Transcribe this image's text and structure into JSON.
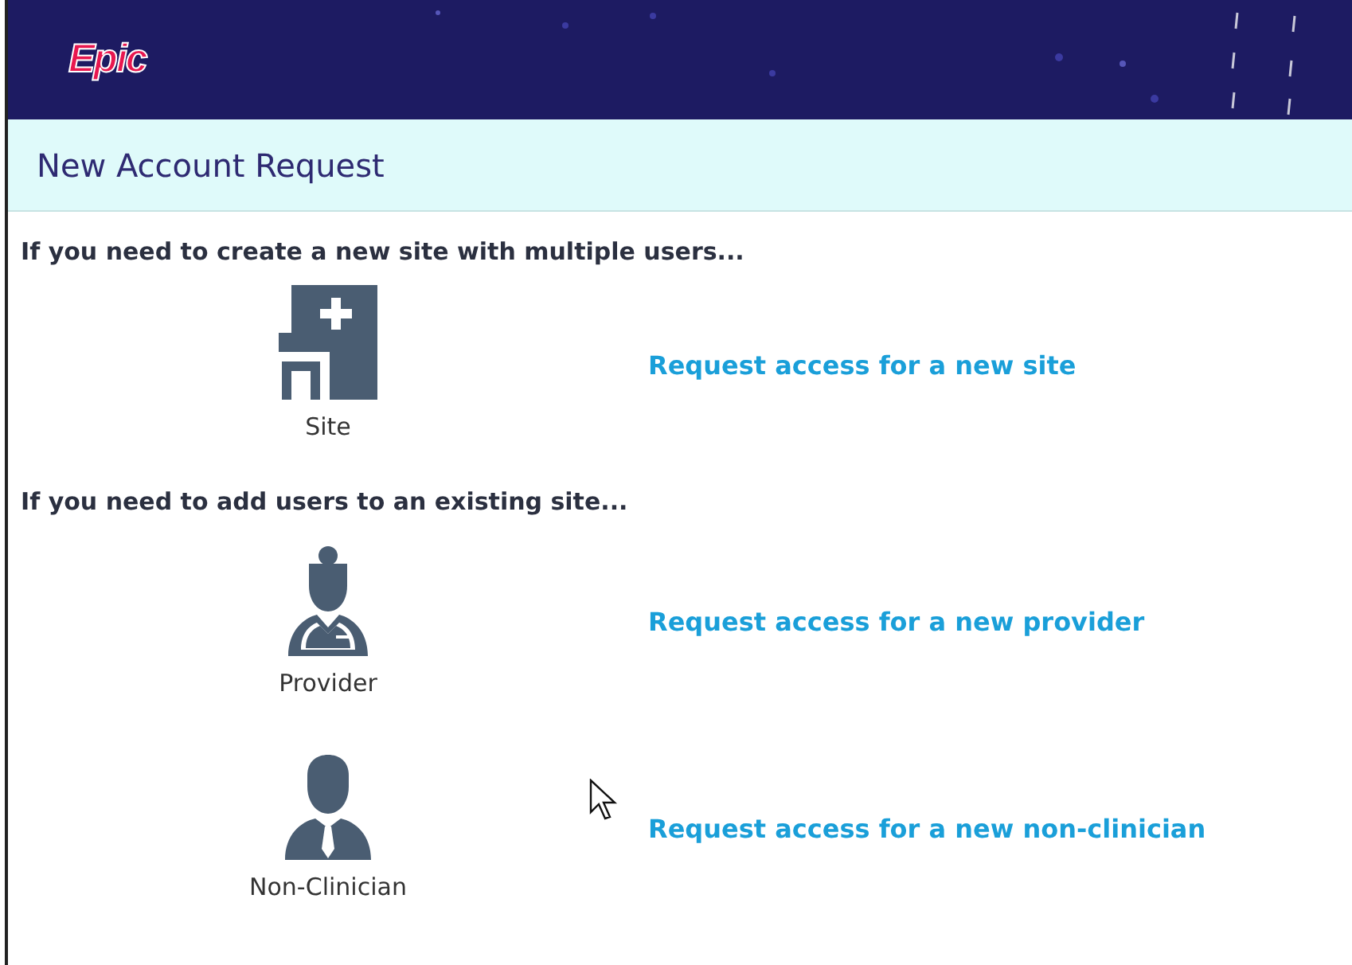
{
  "header": {
    "logo": "Epic"
  },
  "title": "New Account Request",
  "sections": [
    {
      "heading": "If you need to create a new site with multiple users...",
      "options": [
        {
          "kind": "site",
          "label": "Site",
          "link": "Request access for a new site"
        }
      ]
    },
    {
      "heading": "If you need to add users to an existing site...",
      "options": [
        {
          "kind": "provider",
          "label": "Provider",
          "link": "Request access for a new provider"
        },
        {
          "kind": "person",
          "label": "Non-Clinician",
          "link": "Request access for a new non-clinician"
        }
      ]
    }
  ]
}
